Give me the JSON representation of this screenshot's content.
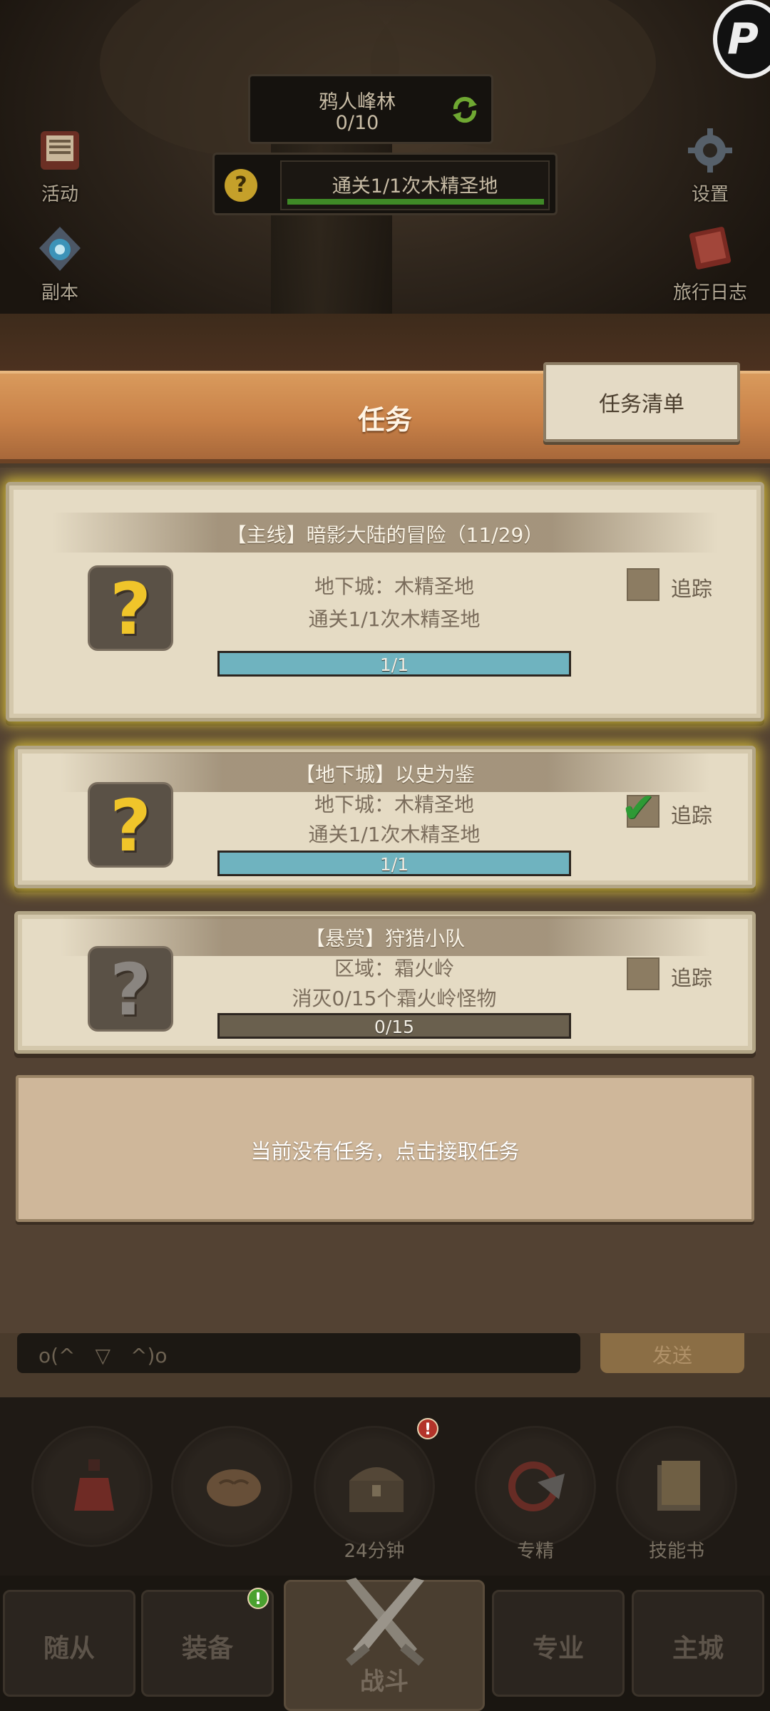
{
  "top_hud": {
    "zone_name": "鸦人峰林",
    "zone_progress": "0/10",
    "tracked_quest_text": "通关1/1次木精圣地",
    "left_buttons": [
      {
        "label": "活动",
        "icon": "event-board-icon"
      },
      {
        "label": "副本",
        "icon": "dungeon-portal-icon"
      }
    ],
    "right_buttons": [
      {
        "label": "设置",
        "icon": "gear-icon"
      },
      {
        "label": "旅行日志",
        "icon": "journal-book-icon"
      }
    ]
  },
  "quest_panel": {
    "title": "任务",
    "list_button": "任务清单",
    "quests": [
      {
        "title": "【主线】暗影大陆的冒险（11/29）",
        "line1": "地下城：木精圣地",
        "line2": "通关1/1次木精圣地",
        "progress_text": "1/1",
        "progress": 1.0,
        "tracked": false,
        "track_label": "追踪",
        "icon": "gold-question-icon"
      },
      {
        "title": "【地下城】以史为鉴",
        "line1": "地下城：木精圣地",
        "line2": "通关1/1次木精圣地",
        "progress_text": "1/1",
        "progress": 1.0,
        "tracked": true,
        "track_label": "追踪",
        "icon": "gold-question-icon"
      },
      {
        "title": "【悬赏】狩猎小队",
        "line1": "区域：霜火岭",
        "line2": "消灭0/15个霜火岭怪物",
        "progress_text": "0/15",
        "progress": 0.0,
        "tracked": false,
        "track_label": "追踪",
        "icon": "grey-question-icon"
      }
    ],
    "empty_slot_text": "当前没有任务，点击接取任务"
  },
  "chat": {
    "input_text": "o(^　▽　^)o",
    "send_label": "发送"
  },
  "skill_slots": [
    {
      "label": "",
      "icon": "potion-icon"
    },
    {
      "label": "",
      "icon": "bread-icon"
    },
    {
      "label": "24分钟",
      "icon": "treasure-chest-icon",
      "badge": "!"
    },
    {
      "label": "专精",
      "icon": "specialization-icon"
    },
    {
      "label": "技能书",
      "icon": "skill-book-icon"
    }
  ],
  "bottom_nav": [
    {
      "label": "随从"
    },
    {
      "label": "装备",
      "badge": "!"
    },
    {
      "label": "战斗",
      "active": true
    },
    {
      "label": "专业"
    },
    {
      "label": "主城"
    }
  ],
  "colors": {
    "progress_fill": "#6fb3bf",
    "quest_card_bg": "#e5dbc4",
    "panel_header": "#c88148",
    "gold_glow": "#ebd23c"
  }
}
